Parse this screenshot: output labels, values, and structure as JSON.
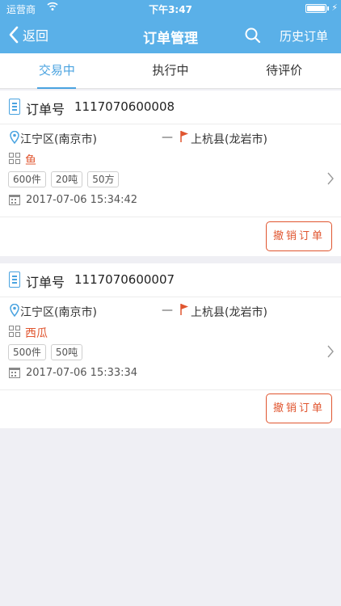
{
  "status_bar": {
    "carrier": "运营商",
    "time": "下午3:47"
  },
  "nav": {
    "back_label": "返回",
    "title": "订单管理",
    "history_label": "历史订单"
  },
  "tabs": [
    {
      "label": "交易中",
      "active": true
    },
    {
      "label": "执行中",
      "active": false
    },
    {
      "label": "待评价",
      "active": false
    }
  ],
  "orders": [
    {
      "order_label": "订单号",
      "order_number": "1117070600008",
      "from": "江宁区(南京市)",
      "dash": "—",
      "to": "上杭县(龙岩市)",
      "goods": "鱼",
      "tags": [
        "600件",
        "20吨",
        "50方"
      ],
      "datetime": "2017-07-06 15:34:42",
      "cancel_label": "撤销订单"
    },
    {
      "order_label": "订单号",
      "order_number": "1117070600007",
      "from": "江宁区(南京市)",
      "dash": "—",
      "to": "上杭县(龙岩市)",
      "goods": "西瓜",
      "tags": [
        "500件",
        "50吨"
      ],
      "datetime": "2017-07-06 15:33:34",
      "cancel_label": "撤销订单"
    }
  ],
  "colors": {
    "header": "#5ab0e8",
    "accent": "#4aa3e0",
    "danger": "#e0552f",
    "background": "#efeff4"
  }
}
